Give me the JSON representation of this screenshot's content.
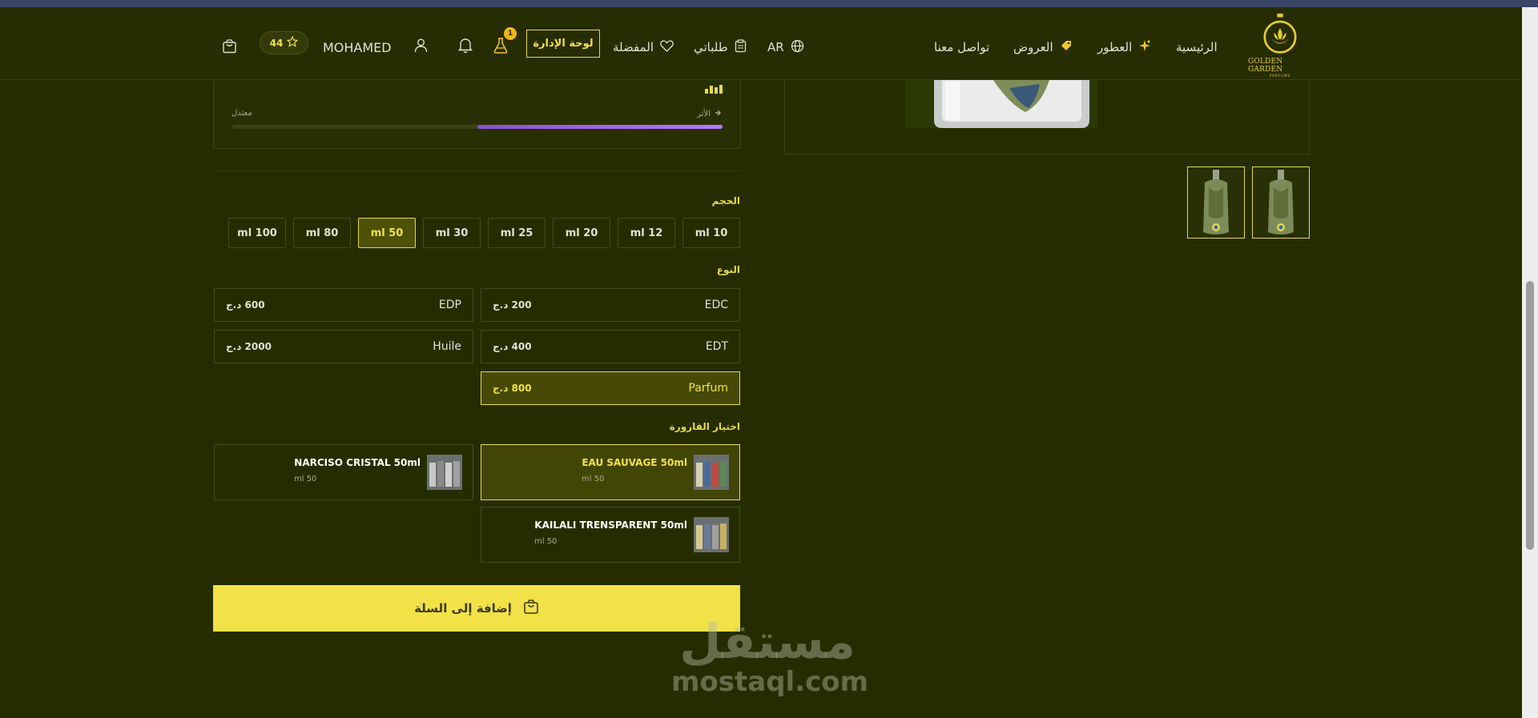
{
  "nav": {
    "home": "الرئيسية",
    "perfumes": "العطور",
    "offers": "العروض",
    "contact": "تواصل معنا",
    "language": "AR",
    "orders": "طلباتي",
    "favorites": "المفضلة",
    "admin": "لوحة الإدارة",
    "lab_badge": "1",
    "username": "MOHAMED",
    "points": "44"
  },
  "logo": {
    "brand": "GOLDEN GARDEN",
    "sub": "PARFUMS"
  },
  "scent": {
    "trail_label": "الأثر",
    "moderate_label": "معتدل",
    "trail_level": 0.5
  },
  "size": {
    "label": "الحجم",
    "options": [
      "ml 10",
      "ml 12",
      "ml 20",
      "ml 25",
      "ml 30",
      "ml 50",
      "ml 80",
      "ml 100"
    ],
    "selected": "ml 50"
  },
  "type": {
    "label": "النوع",
    "options": [
      {
        "name": "EDC",
        "price": "200 د.ج"
      },
      {
        "name": "EDP",
        "price": "600 د.ج"
      },
      {
        "name": "EDT",
        "price": "400 د.ج"
      },
      {
        "name": "Huile",
        "price": "2000 د.ج"
      },
      {
        "name": "Parfum",
        "price": "800 د.ج"
      }
    ],
    "selected": "Parfum"
  },
  "bottle": {
    "label": "اختيار القارورة",
    "options": [
      {
        "name": "EAU SAUVAGE 50ml",
        "size": "ml 50"
      },
      {
        "name": "NARCISO CRISTAL 50ml",
        "size": "ml 50"
      },
      {
        "name": "KAILALI TRENSPARENT 50ml",
        "size": "ml 50"
      }
    ],
    "selected": "EAU SAUVAGE 50ml"
  },
  "cart": {
    "label": "إضافة إلى السلة"
  },
  "watermark": {
    "ar": "مستقل",
    "en": "mostaql.com"
  },
  "colors": {
    "background": "#252d00",
    "accent": "#f3e148",
    "progress": "#b878ff"
  }
}
